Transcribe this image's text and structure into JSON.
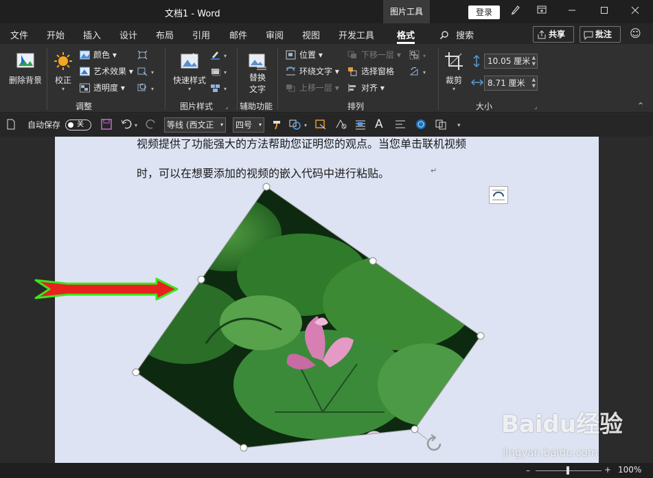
{
  "titlebar": {
    "doc_title": "文档1 -  Word",
    "context_tab": "图片工具",
    "login": "登录"
  },
  "tabs": [
    "文件",
    "开始",
    "插入",
    "设计",
    "布局",
    "引用",
    "邮件",
    "审阅",
    "视图",
    "开发工具",
    "格式"
  ],
  "active_tab": "格式",
  "search_label": "搜索",
  "share_label": "共享",
  "comment_label": "批注",
  "ribbon": {
    "adjust": {
      "label": "调整",
      "remove_bg": "删除背景",
      "corrections": "校正",
      "color": "颜色",
      "artistic": "艺术效果",
      "transparency": "透明度"
    },
    "picture_styles": {
      "label": "图片样式",
      "quick_styles": "快速样式"
    },
    "accessibility": {
      "label": "辅助功能",
      "alt_text_line1": "替换",
      "alt_text_line2": "文字"
    },
    "arrange": {
      "label": "排列",
      "position": "位置",
      "wrap_text": "环绕文字",
      "bring_forward": "上移一层",
      "send_backward": "下移一层",
      "selection_pane": "选择窗格",
      "align": "对齐"
    },
    "size": {
      "label": "大小",
      "crop": "裁剪",
      "height": "10.05 厘米",
      "width": "8.71 厘米"
    }
  },
  "qat": {
    "autosave": "自动保存",
    "autosave_state": "关",
    "font": "等线 (西文正",
    "font_size": "四号"
  },
  "document": {
    "line1": "视频提供了功能强大的方法帮助您证明您的观点。当您单击联机视频",
    "line2": "时，可以在想要添加的视频的嵌入代码中进行粘贴。",
    "return_mark": "↵"
  },
  "statusbar": {
    "zoom": "100%"
  },
  "watermark": {
    "brand": "Baidu经验",
    "url": "jingyan.baidu.com"
  },
  "colors": {
    "arrow_fill": "#e8211c",
    "arrow_outline": "#39e61e",
    "page_bg": "#dde3f2"
  }
}
